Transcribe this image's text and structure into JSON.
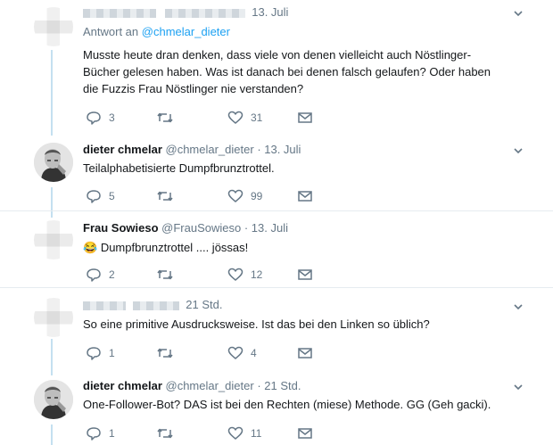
{
  "tweets": [
    {
      "name": "",
      "handle": "",
      "time": "13. Juli",
      "reply_prefix": "Antwort an",
      "reply_handle": "@chmelar_dieter",
      "text_lines": [
        "Musste heute dran denken, dass viele von denen vielleicht auch Nöstlinger-",
        "Bücher gelesen haben. Was ist danach bei denen falsch gelaufen? Oder haben",
        "die Fuzzis Frau Nöstlinger nie verstanden?"
      ],
      "replies": "3",
      "retweets": "",
      "likes": "31"
    },
    {
      "name": "dieter chmelar",
      "handle": "@chmelar_dieter",
      "time": "· 13. Juli",
      "text_lines": [
        "Teilalphabetisierte Dumpfbrunztrottel."
      ],
      "replies": "5",
      "retweets": "",
      "likes": "99"
    },
    {
      "name": "Frau Sowieso",
      "handle": "@FrauSowieso",
      "time": "· 13. Juli",
      "emoji": "😂",
      "text_lines": [
        "Dumpfbrunztrottel .... jössas!"
      ],
      "replies": "2",
      "retweets": "",
      "likes": "12"
    },
    {
      "name": "",
      "handle": "",
      "time": "21 Std.",
      "text_lines": [
        "So eine primitive Ausdrucksweise. Ist das bei den Linken so üblich?"
      ],
      "replies": "1",
      "retweets": "",
      "likes": "4"
    },
    {
      "name": "dieter chmelar",
      "handle": "@chmelar_dieter",
      "time": "· 21 Std.",
      "text_lines": [
        "One-Follower-Bot? DAS ist bei den Rechten (miese) Methode. GG (Geh gacki)."
      ],
      "replies": "1",
      "retweets": "",
      "likes": "11"
    }
  ],
  "icons": {
    "reply": "reply-icon",
    "retweet": "retweet-icon",
    "like": "heart-icon",
    "dm": "envelope-icon",
    "more": "chevron-down-icon"
  },
  "colors": {
    "link": "#1da1f2",
    "muted": "#657786",
    "thread_line": "#c4e0f0",
    "separator": "#e6ecf0"
  }
}
